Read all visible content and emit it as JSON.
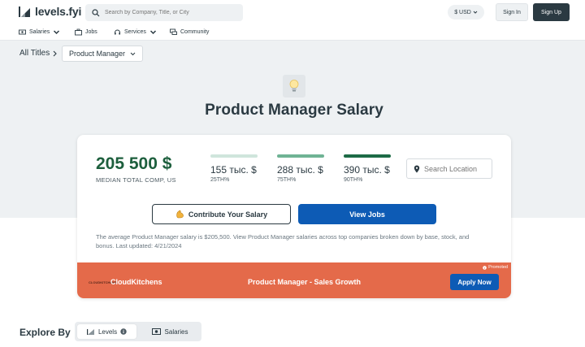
{
  "header": {
    "logo_text": "levels.fyi",
    "search_placeholder": "Search by Company, Title, or City",
    "currency": "$ USD",
    "signin_label": "Sign In",
    "signup_label": "Sign Up"
  },
  "nav": {
    "items": [
      {
        "label": "Salaries",
        "icon": "money-icon",
        "has_dropdown": true
      },
      {
        "label": "Jobs",
        "icon": "briefcase-icon",
        "has_dropdown": false
      },
      {
        "label": "Services",
        "icon": "headset-icon",
        "has_dropdown": true
      },
      {
        "label": "Community",
        "icon": "chat-icon",
        "has_dropdown": false
      }
    ]
  },
  "breadcrumb": {
    "all_titles": "All Titles",
    "selected": "Product Manager"
  },
  "page": {
    "title": "Product Manager Salary"
  },
  "salary": {
    "median_value": "205 500 $",
    "median_label": "MEDIAN TOTAL COMP, US",
    "percentiles": [
      {
        "value": "155 тыс. $",
        "label": "25TH%",
        "color": "#cfe5dc"
      },
      {
        "value": "288 тыс. $",
        "label": "75TH%",
        "color": "#6fb394"
      },
      {
        "value": "390 тыс. $",
        "label": "90TH%",
        "color": "#1d6b46"
      }
    ],
    "location_placeholder": "Search Location",
    "contribute_label": "Contribute Your Salary",
    "view_jobs_label": "View Jobs",
    "description": "The average Product Manager salary is $205,500. View Product Manager salaries across top companies broken down by base, stock, and bonus. Last updated: 4/21/2024"
  },
  "promo": {
    "promoted_label": "Promoted",
    "logo_text": "CLOUDKITCHENS",
    "company": "CloudKitchens",
    "job_title": "Product Manager - Sales Growth",
    "apply_label": "Apply Now",
    "color": "#e46a4a"
  },
  "explore": {
    "label": "Explore By",
    "tab_levels": "Levels",
    "tab_salaries": "Salaries"
  }
}
